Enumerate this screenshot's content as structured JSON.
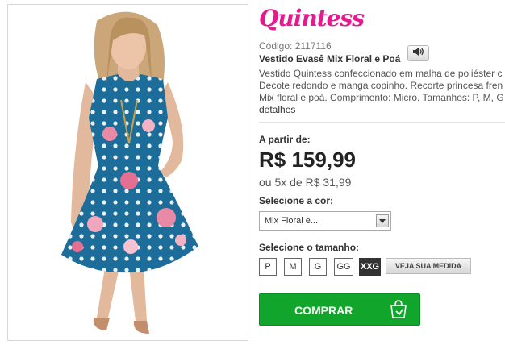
{
  "product": {
    "brand": "Quintess",
    "code": "Código: 2117116",
    "name": "Vestido Evasê Mix Floral e Poá",
    "description_lines": [
      "Vestido Quintess confeccionado em malha de poliéster c",
      "Decote redondo e manga copinho. Recorte princesa fren",
      "Mix floral e poá. Comprimento: Micro. Tamanhos: P, M, G"
    ],
    "details_link": "detalhes"
  },
  "pricing": {
    "from_label": "A partir de:",
    "price": "R$ 159,99",
    "installments": "ou 5x de R$ 31,99"
  },
  "color_selector": {
    "label": "Selecione a cor:",
    "selected": "Mix Floral e..."
  },
  "size_selector": {
    "label": "Selecione o tamanho:",
    "sizes": [
      "P",
      "M",
      "G",
      "GG",
      "XXG"
    ],
    "selected": "XXG",
    "measure_button": "VEJA SUA MEDIDA"
  },
  "buy_button": {
    "label": "COMPRAR"
  },
  "icons": {
    "audio": "speaker-icon",
    "dropdown": "chevron-down-icon",
    "bag": "shopping-bag-icon"
  },
  "colors": {
    "brand": "#e6198f",
    "buy": "#12a52c",
    "dress": "#1d6d9a"
  }
}
